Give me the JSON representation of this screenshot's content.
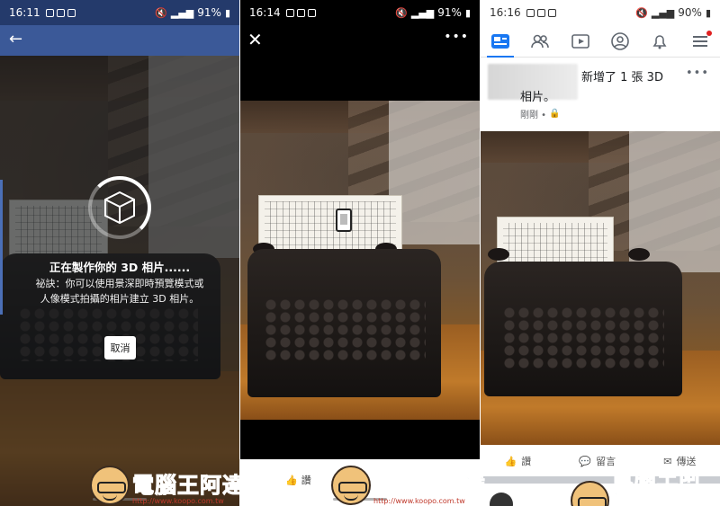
{
  "panel1": {
    "status": {
      "time": "16:11",
      "battery": "91%"
    },
    "back_icon": "←",
    "loading_title": "正在製作你的 3D 相片......",
    "tip": "祕訣：你可以使用景深即時預覽模式或人像模式拍攝的相片建立 3D 相片。",
    "cancel_label": "取消"
  },
  "panel2": {
    "status": {
      "time": "16:14",
      "battery": "91%"
    },
    "close_icon": "✕",
    "more_icon": "•••",
    "like_label": "讚"
  },
  "panel3": {
    "status": {
      "time": "16:16",
      "battery": "90%"
    },
    "post_text": "新增了 1 張 3D 相片。",
    "post_time": "剛剛 •",
    "more_icon": "•••",
    "actions": {
      "like": "讚",
      "comment": "留言",
      "share": "傳送"
    }
  },
  "watermark": {
    "brand": "電腦王阿達",
    "url": "http://www.koopo.com.tw"
  },
  "colors": {
    "facebook_blue": "#3b5998",
    "statusbar_dark": "#243a6b",
    "brand_blue": "#1877f2"
  }
}
